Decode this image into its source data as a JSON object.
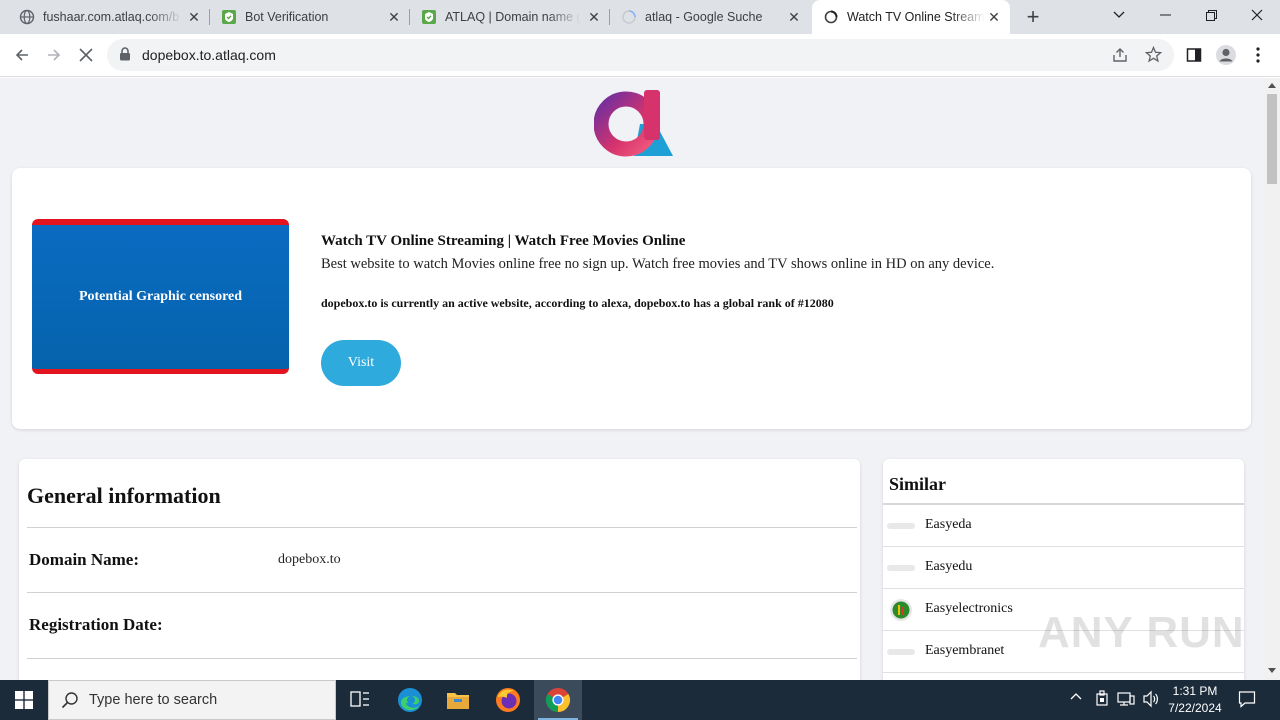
{
  "browser": {
    "tabs": [
      {
        "title": "fushaar.com.atlaq.com/b",
        "favicon": "globe-icon",
        "active": false
      },
      {
        "title": "Bot Verification",
        "favicon": "shield-check-icon",
        "active": false
      },
      {
        "title": "ATLAQ | Domain name g",
        "favicon": "shield-check-icon",
        "active": false
      },
      {
        "title": "atlaq - Google Suche",
        "favicon": "loading-spinner-icon",
        "active": false
      },
      {
        "title": "Watch TV Online Streami",
        "favicon": "globe-icon",
        "active": true
      }
    ],
    "address": "dopebox.to.atlaq.com"
  },
  "page": {
    "hero": {
      "thumbnail_text": "Potential Graphic censored",
      "title": "Watch TV Online Streaming | Watch Free Movies Online",
      "description": "Best website to watch Movies online free no sign up. Watch free movies and TV shows online in HD on any device.",
      "rank_note": "dopebox.to is currently an active website, according to alexa, dopebox.to has a global rank of #12080",
      "visit_label": "Visit"
    },
    "general_info": {
      "heading": "General information",
      "rows": [
        {
          "label": "Domain Name:",
          "value": "dopebox.to"
        },
        {
          "label": "Registration Date:",
          "value": ""
        }
      ]
    },
    "similar": {
      "heading": "Similar",
      "items": [
        {
          "name": "Easyeda",
          "icon": "placeholder"
        },
        {
          "name": "Easyedu",
          "icon": "placeholder"
        },
        {
          "name": "Easyelectronics",
          "icon": "easyelectronics-logo"
        },
        {
          "name": "Easyembranet",
          "icon": "placeholder"
        }
      ]
    },
    "watermark": "ANY RUN"
  },
  "taskbar": {
    "search_placeholder": "Type here to search",
    "time": "1:31 PM",
    "date": "7/22/2024"
  },
  "colors": {
    "visit_button": "#2eaadc",
    "thumbnail_blue": "#0a6bc1",
    "thumbnail_border": "#e3141e"
  }
}
